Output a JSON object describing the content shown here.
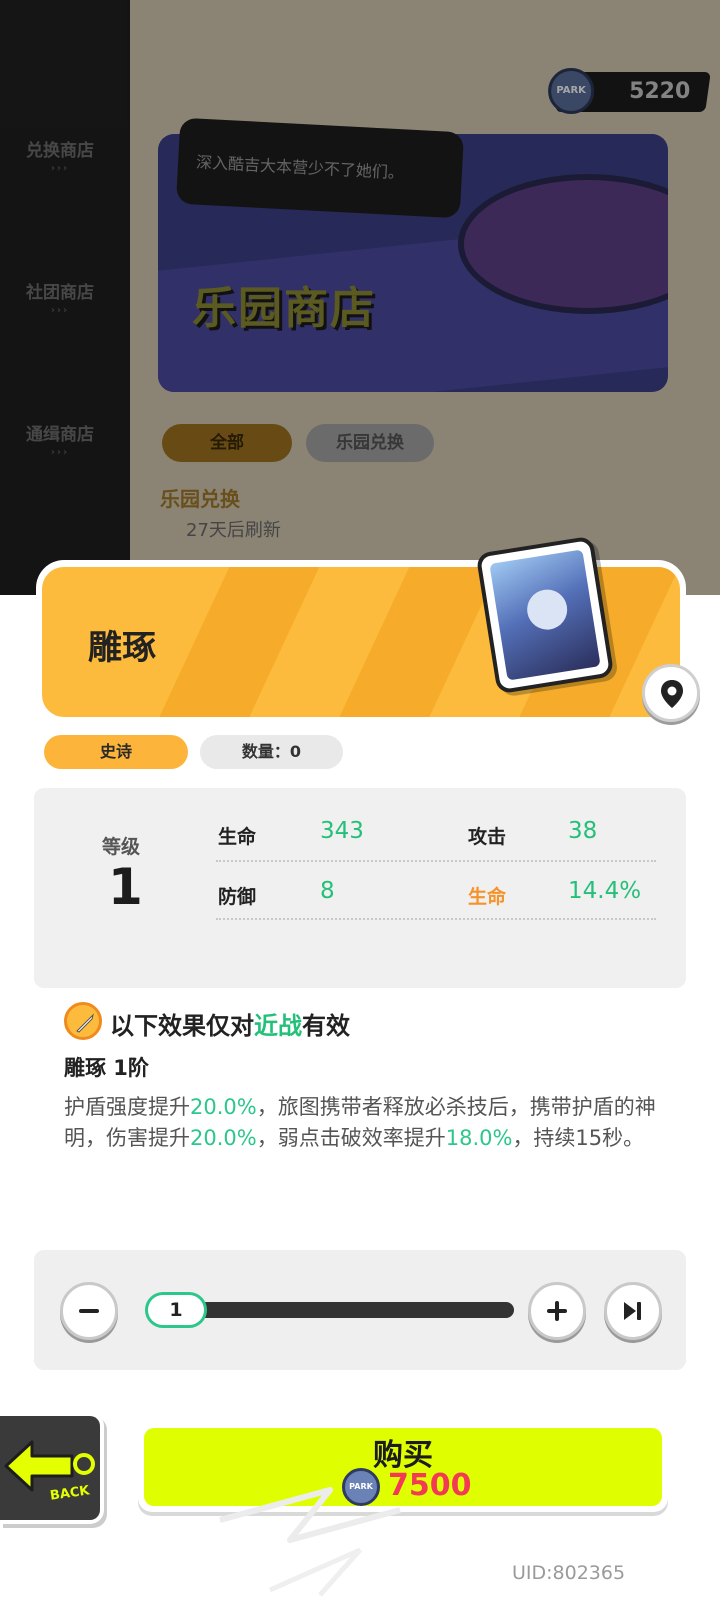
{
  "shop": {
    "sidebar": [
      {
        "label": "兑换商店"
      },
      {
        "label": "社团商店"
      },
      {
        "label": "通缉商店"
      }
    ],
    "currency_amount": "5220",
    "banner_title": "乐园商店",
    "banner_quote": "深入酷吉大本营少不了她们。",
    "tabs": [
      {
        "label": "全部"
      },
      {
        "label": "乐园兑换"
      }
    ],
    "section_title": "乐园兑换",
    "refresh_text": "27天后刷新"
  },
  "item": {
    "name": "雕琢",
    "rarity": "史诗",
    "quantity": "数量：0",
    "level_label": "等级",
    "level_value": "1",
    "stats": [
      {
        "label": "生命",
        "value": "343"
      },
      {
        "label": "攻击",
        "value": "38"
      },
      {
        "label": "防御",
        "value": "8"
      },
      {
        "label": "生命",
        "value": "14.4%"
      }
    ],
    "effect": {
      "prefix": "以下效果仅对",
      "highlight": "近战",
      "suffix": "有效"
    },
    "tier_title": "雕琢 1阶",
    "description": {
      "p1": "护盾强度提升",
      "v1": "20.0%",
      "p2": "，旅图携带者释放必杀技后，携带护盾的神明，伤害提升",
      "v2": "20.0%",
      "p3": "，弱点击破效率提升",
      "v3": "18.0%",
      "p4": "，持续15秒。"
    }
  },
  "purchase": {
    "selected_qty": "1",
    "back_label": "BACK",
    "buy_label": "购买",
    "price": "7500"
  },
  "uid": "UID:802365",
  "colors": {
    "accent_orange": "#fdbb3d",
    "stat_green": "#24c07a",
    "buy_yellow": "#dfff00",
    "price_red": "#f23a55"
  }
}
